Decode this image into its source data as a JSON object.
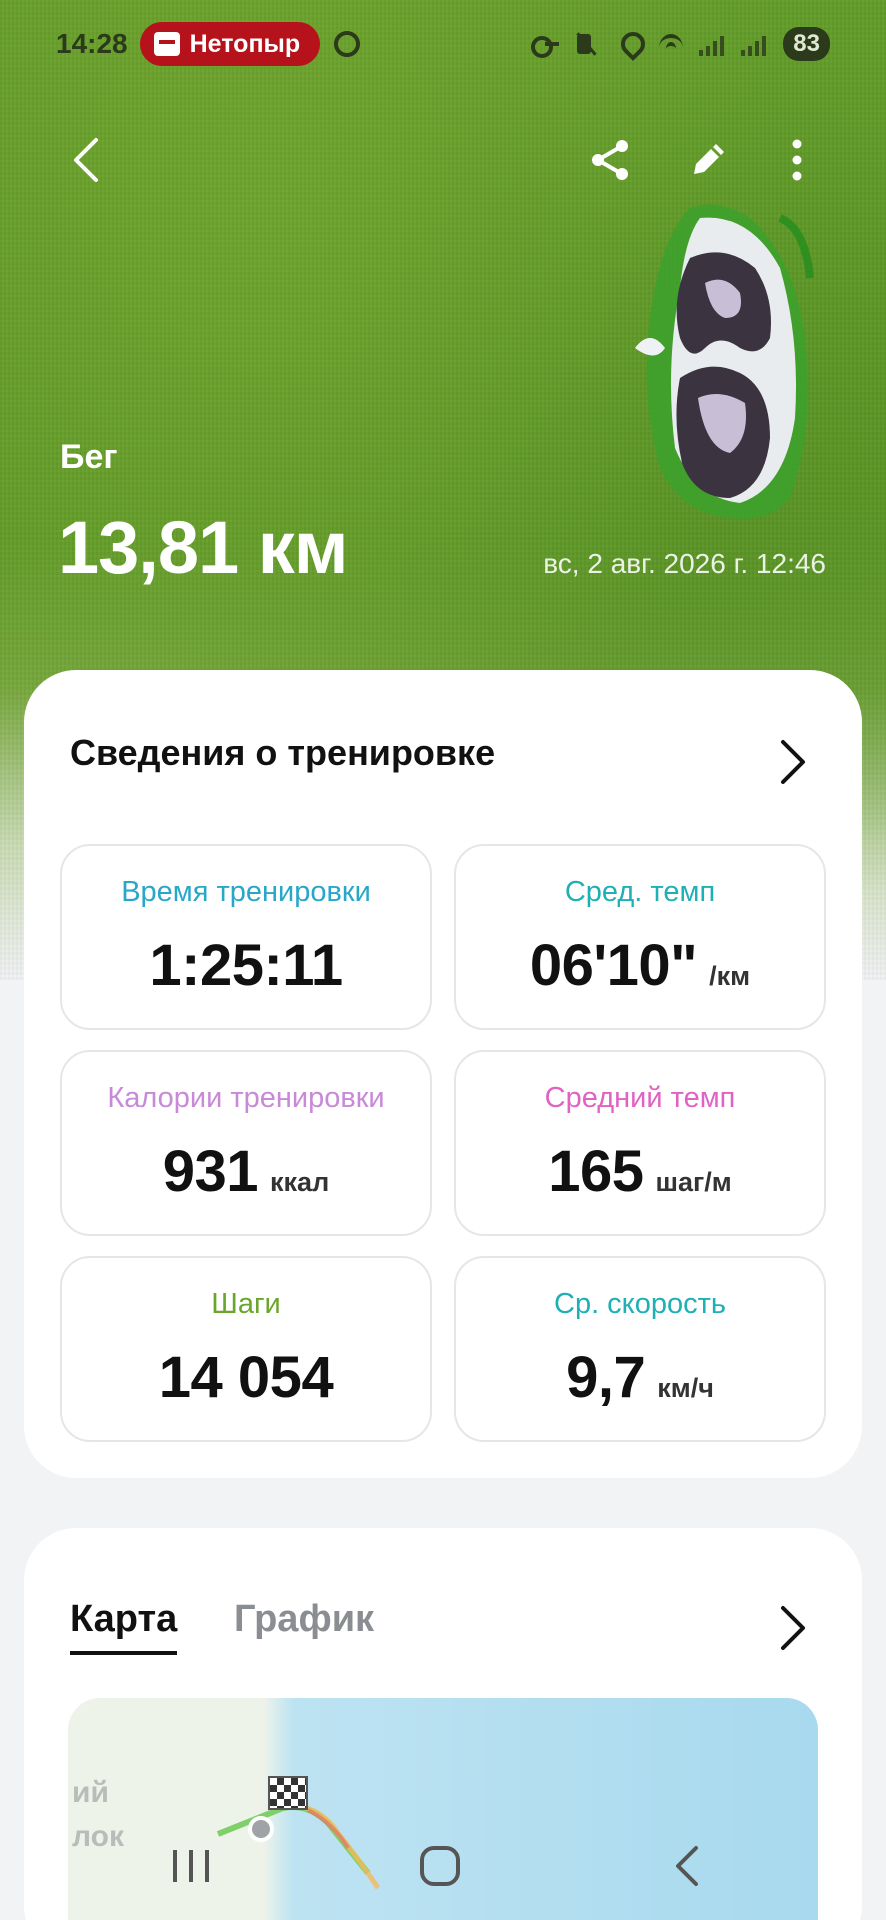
{
  "status_bar": {
    "time": "14:28",
    "vpn_label": "Нетопыр",
    "battery": "83",
    "icons": [
      "key-icon",
      "mute-icon",
      "location-icon",
      "wifi-icon",
      "signal-icon",
      "signal-icon"
    ]
  },
  "nav": {
    "icons": [
      "back-icon",
      "share-icon",
      "edit-icon",
      "more-icon"
    ]
  },
  "workout": {
    "type": "Бег",
    "distance": "13,81 км",
    "datetime": "вс, 2 авг. 2026 г. 12:46"
  },
  "details": {
    "title": "Сведения о тренировке",
    "stats": [
      {
        "label": "Время тренировки",
        "value": "1:25:11",
        "unit": ""
      },
      {
        "label": "Сред. темп",
        "value": "06'10\"",
        "unit": "/км"
      },
      {
        "label": "Калории тренировки",
        "value": "931",
        "unit": "ккал"
      },
      {
        "label": "Средний темп",
        "value": "165",
        "unit": "шаг/м"
      },
      {
        "label": "Шаги",
        "value": "14 054",
        "unit": ""
      },
      {
        "label": "Ср. скорость",
        "value": "9,7",
        "unit": "км/ч"
      }
    ]
  },
  "map_section": {
    "tabs": [
      {
        "label": "Карта",
        "active": true
      },
      {
        "label": "График",
        "active": false
      }
    ],
    "map_text_1": "ий",
    "map_text_2": "лок"
  },
  "colors": {
    "vpn_red": "#b5121b",
    "label_blue": "#28a7c9",
    "label_teal": "#1fb0b5",
    "label_lilac": "#c88ad8",
    "label_pink": "#e062c3",
    "label_green": "#6aa62a"
  }
}
